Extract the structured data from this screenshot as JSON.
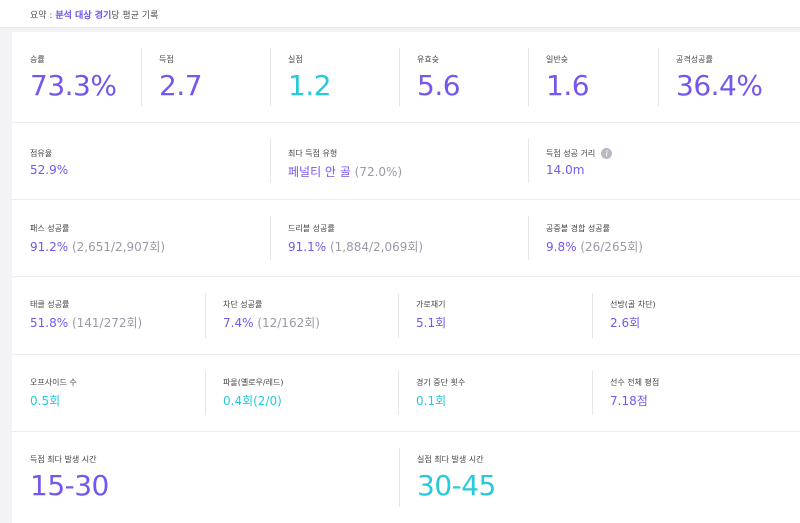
{
  "summary": {
    "prefix": "요약 : ",
    "highlight": "분석 대상 경기",
    "suffix": "당 평균 기록"
  },
  "row1": [
    {
      "label": "승률",
      "value": "73.3%",
      "color": "purple"
    },
    {
      "label": "득점",
      "value": "2.7",
      "color": "purple"
    },
    {
      "label": "실점",
      "value": "1.2",
      "color": "cyan"
    },
    {
      "label": "유효슛",
      "value": "5.6",
      "color": "purple"
    },
    {
      "label": "일반슛",
      "value": "1.6",
      "color": "purple"
    },
    {
      "label": "공격성공률",
      "value": "36.4%",
      "color": "purple"
    }
  ],
  "row2": [
    {
      "label": "점유율",
      "value": "52.9%",
      "extra": ""
    },
    {
      "label": "최다 득점 유형",
      "value": "페널티 안 골",
      "extra": " (72.0%)"
    },
    {
      "label": "득점 성공 거리",
      "value": "14.0m",
      "extra": "",
      "info_icon": "info-icon"
    }
  ],
  "row3": [
    {
      "label": "패스 성공률",
      "value": "91.2%",
      "extra": " (2,651/2,907회)"
    },
    {
      "label": "드리블 성공률",
      "value": "91.1%",
      "extra": " (1,884/2,069회)"
    },
    {
      "label": "공중볼 경합 성공률",
      "value": "9.8%",
      "extra": " (26/265회)"
    }
  ],
  "row4": [
    {
      "label": "태클 성공률",
      "value": "51.8%",
      "extra": " (141/272회)"
    },
    {
      "label": "차단 성공률",
      "value": "7.4%",
      "extra": " (12/162회)"
    },
    {
      "label": "가로채기",
      "value": "5.1회",
      "extra": ""
    },
    {
      "label": "선방(골 차단)",
      "value": "2.6회",
      "extra": ""
    }
  ],
  "row5": [
    {
      "label": "오프사이드 수",
      "value": "0.5회"
    },
    {
      "label": "파울(옐로우/레드)",
      "value": "0.4회(2/0)"
    },
    {
      "label": "경기 중단 횟수",
      "value": "0.1회"
    },
    {
      "label": "선수 전체 평점",
      "value": "7.18점"
    }
  ],
  "row6": [
    {
      "label": "득점 최다 발생 시간",
      "value": "15-30",
      "color": "purple"
    },
    {
      "label": "실점 최다 발생 시간",
      "value": "30-45",
      "color": "cyan"
    }
  ],
  "colors": {
    "purple": "#7656ee",
    "cyan": "#29c9dc",
    "muted": "#9a9aa8"
  }
}
